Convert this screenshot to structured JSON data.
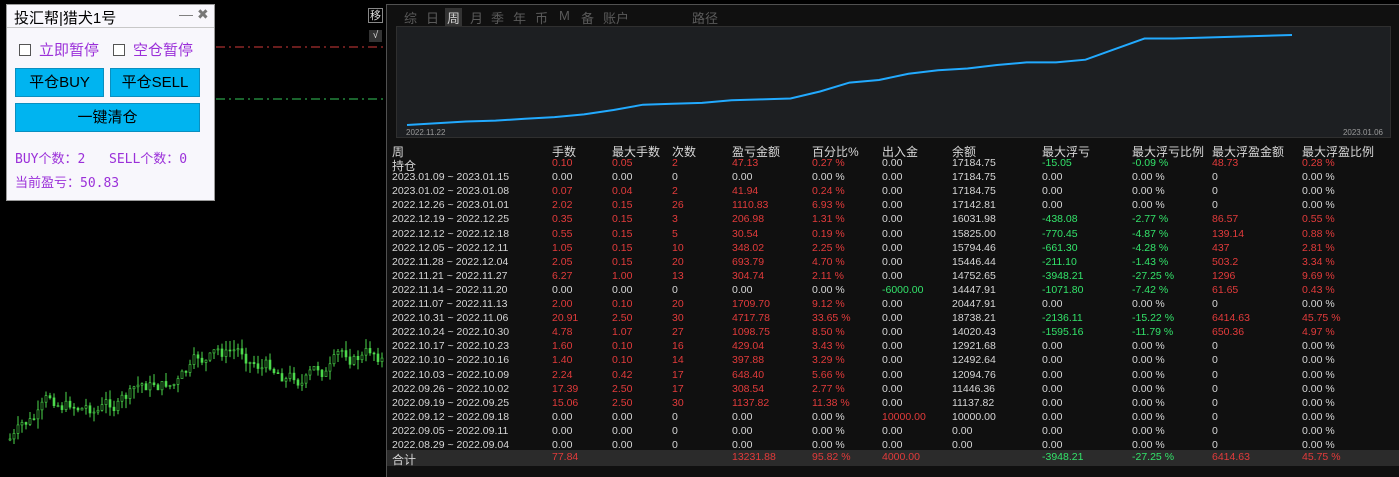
{
  "panel": {
    "title": "投汇帮|猎犬1号",
    "minimize_icon": "—",
    "close_icon": "✖",
    "checkbox_pause": "立即暂停",
    "checkbox_empty_pause": "空仓暂停",
    "btn_close_buy": "平仓BUY",
    "btn_close_sell": "平仓SELL",
    "btn_close_all": "一键清仓",
    "buy_count": "BUY个数：2",
    "sell_count": "SELL个数：0",
    "pnl": "当前盈亏：50.83"
  },
  "chart_tools": {
    "zoom_glyph": "移",
    "check_glyph": "√"
  },
  "report": {
    "tabs": [
      "综",
      "日",
      "周",
      "月",
      "季",
      "年",
      "币",
      "M",
      "备",
      "账户",
      "路径"
    ],
    "active_tab": 2,
    "mini_chart": {
      "x_start": "2022.11.22",
      "x_end": "2023.01.06",
      "values": [
        2,
        4,
        6,
        7,
        9,
        11,
        14,
        19,
        25,
        26,
        27,
        30,
        31,
        32,
        40,
        50,
        53,
        60,
        64,
        66,
        70,
        73,
        73,
        76,
        88,
        100,
        100,
        101,
        102,
        103,
        104
      ]
    },
    "headers": [
      "周",
      "手数",
      "最大手数",
      "次数",
      "盈亏金额",
      "百分比%",
      "出入金",
      "余额",
      "最大浮亏",
      "最大浮亏比例",
      "最大浮盈金额",
      "最大浮盈比例"
    ],
    "rows": [
      [
        "持仓",
        "0.10",
        "0.05",
        "2",
        "47.13",
        "0.27 %",
        "0.00",
        "17184.75",
        "-15.05",
        "-0.09 %",
        "48.73",
        "0.28 %"
      ],
      [
        "2023.01.09 ~ 2023.01.15",
        "0.00",
        "0.00",
        "0",
        "0.00",
        "0.00 %",
        "0.00",
        "17184.75",
        "0.00",
        "0.00 %",
        "0",
        "0.00 %"
      ],
      [
        "2023.01.02 ~ 2023.01.08",
        "0.07",
        "0.04",
        "2",
        "41.94",
        "0.24 %",
        "0.00",
        "17184.75",
        "0.00",
        "0.00 %",
        "0",
        "0.00 %"
      ],
      [
        "2022.12.26 ~ 2023.01.01",
        "2.02",
        "0.15",
        "26",
        "1110.83",
        "6.93 %",
        "0.00",
        "17142.81",
        "0.00",
        "0.00 %",
        "0",
        "0.00 %"
      ],
      [
        "2022.12.19 ~ 2022.12.25",
        "0.35",
        "0.15",
        "3",
        "206.98",
        "1.31 %",
        "0.00",
        "16031.98",
        "-438.08",
        "-2.77 %",
        "86.57",
        "0.55 %"
      ],
      [
        "2022.12.12 ~ 2022.12.18",
        "0.55",
        "0.15",
        "5",
        "30.54",
        "0.19 %",
        "0.00",
        "15825.00",
        "-770.45",
        "-4.87 %",
        "139.14",
        "0.88 %"
      ],
      [
        "2022.12.05 ~ 2022.12.11",
        "1.05",
        "0.15",
        "10",
        "348.02",
        "2.25 %",
        "0.00",
        "15794.46",
        "-661.30",
        "-4.28 %",
        "437",
        "2.81 %"
      ],
      [
        "2022.11.28 ~ 2022.12.04",
        "2.05",
        "0.15",
        "20",
        "693.79",
        "4.70 %",
        "0.00",
        "15446.44",
        "-211.10",
        "-1.43 %",
        "503.2",
        "3.34 %"
      ],
      [
        "2022.11.21 ~ 2022.11.27",
        "6.27",
        "1.00",
        "13",
        "304.74",
        "2.11 %",
        "0.00",
        "14752.65",
        "-3948.21",
        "-27.25 %",
        "1296",
        "9.69 %"
      ],
      [
        "2022.11.14 ~ 2022.11.20",
        "0.00",
        "0.00",
        "0",
        "0.00",
        "0.00 %",
        "-6000.00",
        "14447.91",
        "-1071.80",
        "-7.42 %",
        "61.65",
        "0.43 %"
      ],
      [
        "2022.11.07 ~ 2022.11.13",
        "2.00",
        "0.10",
        "20",
        "1709.70",
        "9.12 %",
        "0.00",
        "20447.91",
        "0.00",
        "0.00 %",
        "0",
        "0.00 %"
      ],
      [
        "2022.10.31 ~ 2022.11.06",
        "20.91",
        "2.50",
        "30",
        "4717.78",
        "33.65 %",
        "0.00",
        "18738.21",
        "-2136.11",
        "-15.22 %",
        "6414.63",
        "45.75 %"
      ],
      [
        "2022.10.24 ~ 2022.10.30",
        "4.78",
        "1.07",
        "27",
        "1098.75",
        "8.50 %",
        "0.00",
        "14020.43",
        "-1595.16",
        "-11.79 %",
        "650.36",
        "4.97 %"
      ],
      [
        "2022.10.17 ~ 2022.10.23",
        "1.60",
        "0.10",
        "16",
        "429.04",
        "3.43 %",
        "0.00",
        "12921.68",
        "0.00",
        "0.00 %",
        "0",
        "0.00 %"
      ],
      [
        "2022.10.10 ~ 2022.10.16",
        "1.40",
        "0.10",
        "14",
        "397.88",
        "3.29 %",
        "0.00",
        "12492.64",
        "0.00",
        "0.00 %",
        "0",
        "0.00 %"
      ],
      [
        "2022.10.03 ~ 2022.10.09",
        "2.24",
        "0.42",
        "17",
        "648.40",
        "5.66 %",
        "0.00",
        "12094.76",
        "0.00",
        "0.00 %",
        "0",
        "0.00 %"
      ],
      [
        "2022.09.26 ~ 2022.10.02",
        "17.39",
        "2.50",
        "17",
        "308.54",
        "2.77 %",
        "0.00",
        "11446.36",
        "0.00",
        "0.00 %",
        "0",
        "0.00 %"
      ],
      [
        "2022.09.19 ~ 2022.09.25",
        "15.06",
        "2.50",
        "30",
        "1137.82",
        "11.38 %",
        "0.00",
        "11137.82",
        "0.00",
        "0.00 %",
        "0",
        "0.00 %"
      ],
      [
        "2022.09.12 ~ 2022.09.18",
        "0.00",
        "0.00",
        "0",
        "0.00",
        "0.00 %",
        "10000.00",
        "10000.00",
        "0.00",
        "0.00 %",
        "0",
        "0.00 %"
      ],
      [
        "2022.09.05 ~ 2022.09.11",
        "0.00",
        "0.00",
        "0",
        "0.00",
        "0.00 %",
        "0.00",
        "0.00",
        "0.00",
        "0.00 %",
        "0",
        "0.00 %"
      ],
      [
        "2022.08.29 ~ 2022.09.04",
        "0.00",
        "0.00",
        "0",
        "0.00",
        "0.00 %",
        "0.00",
        "0.00",
        "0.00",
        "0.00 %",
        "0",
        "0.00 %"
      ]
    ],
    "total": [
      "合计",
      "77.84",
      "",
      "",
      "13231.88",
      "95.82 %",
      "4000.00",
      "",
      "-3948.21",
      "-27.25 %",
      "6414.63",
      "45.75 %"
    ]
  },
  "colors": {
    "red": "#e23b3b",
    "green": "#33e36a",
    "white": "#d6d6d6",
    "accent": "#00b4f0",
    "mini_line": "#22aaff"
  }
}
